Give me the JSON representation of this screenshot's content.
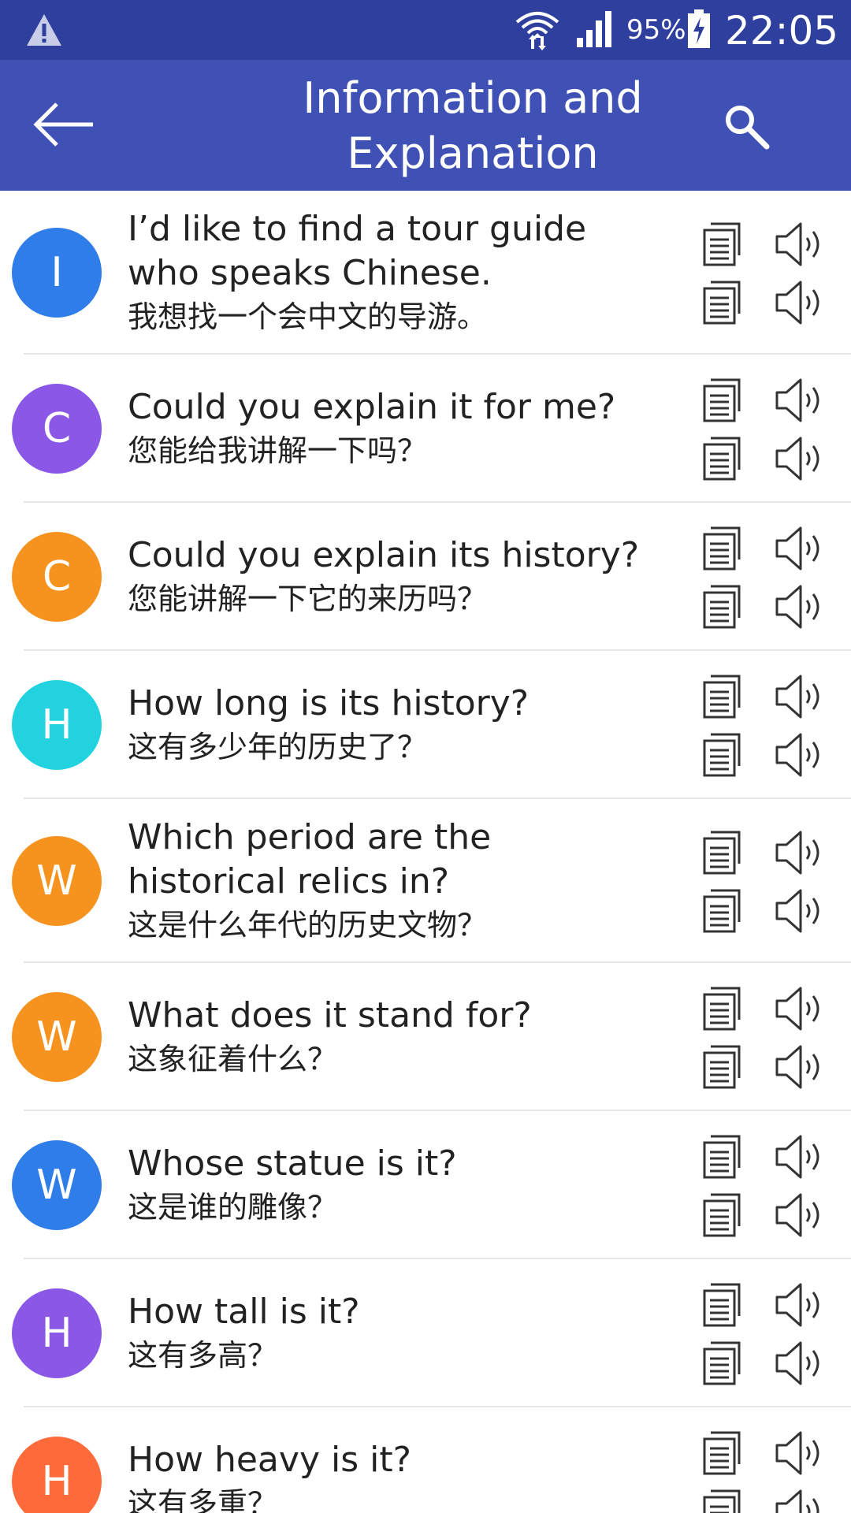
{
  "status_bar": {
    "battery_percent": "95%",
    "time": "22:05"
  },
  "app_bar": {
    "title_line1": "Information and",
    "title_line2": "Explanation"
  },
  "phrases": [
    {
      "letter": "I",
      "color": "#2f7de9",
      "en": "I’d like to find a tour guide who speaks Chinese.",
      "zh": "我想找一个会中文的导游。"
    },
    {
      "letter": "C",
      "color": "#8a57e6",
      "en": "Could you explain it for me?",
      "zh": "您能给我讲解一下吗？"
    },
    {
      "letter": "C",
      "color": "#f6921e",
      "en": "Could you explain its history?",
      "zh": "您能讲解一下它的来历吗？"
    },
    {
      "letter": "H",
      "color": "#22d3df",
      "en": "How long is its history?",
      "zh": "这有多少年的历史了？"
    },
    {
      "letter": "W",
      "color": "#f6921e",
      "en": "Which period are the historical relics in?",
      "zh": "这是什么年代的历史文物？"
    },
    {
      "letter": "W",
      "color": "#f6921e",
      "en": "What does it stand for?",
      "zh": "这象征着什么？"
    },
    {
      "letter": "W",
      "color": "#2f7de9",
      "en": "Whose statue is it?",
      "zh": "这是谁的雕像？"
    },
    {
      "letter": "H",
      "color": "#8a57e6",
      "en": "How tall is it?",
      "zh": "这有多高？"
    },
    {
      "letter": "H",
      "color": "#ff6a3a",
      "en": "How heavy is it?",
      "zh": "这有多重？"
    }
  ]
}
